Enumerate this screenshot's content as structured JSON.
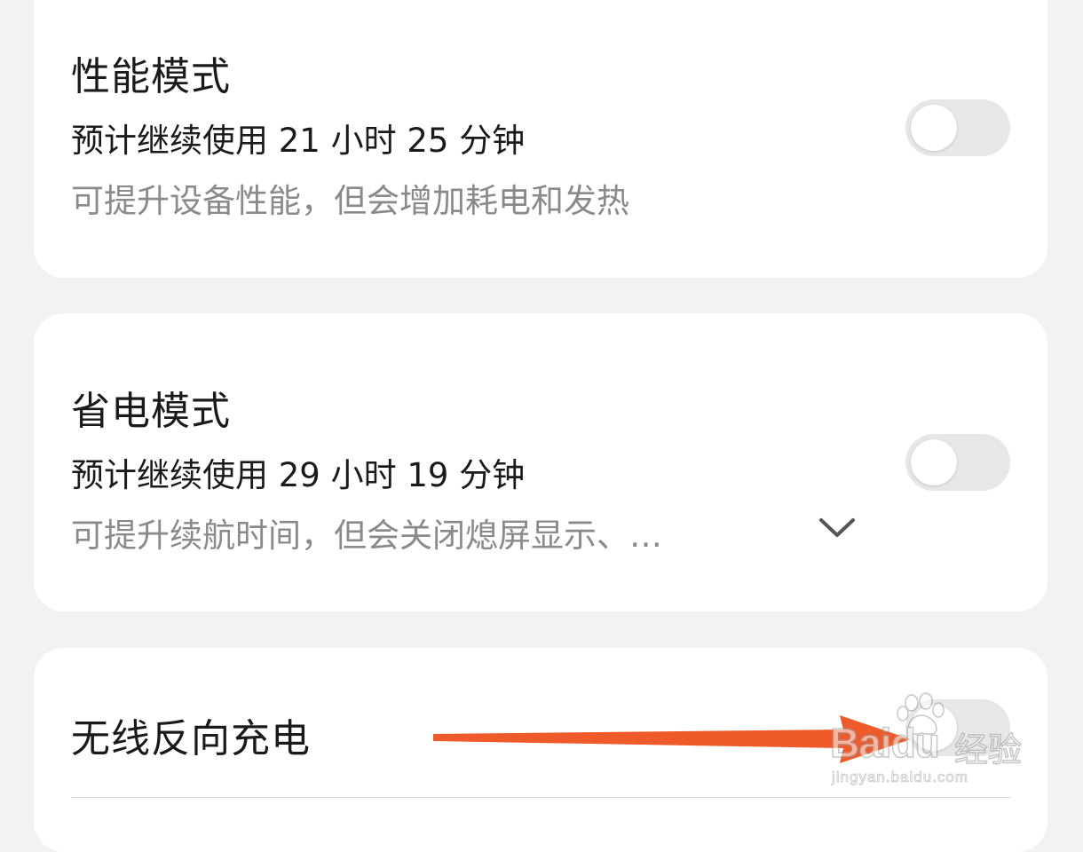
{
  "settings": {
    "performance_mode": {
      "title": "性能模式",
      "estimate": "预计继续使用 21 小时 25 分钟",
      "description": "可提升设备性能，但会增加耗电和发热",
      "enabled": false
    },
    "power_saving_mode": {
      "title": "省电模式",
      "estimate": "预计继续使用 29 小时 19 分钟",
      "description": "可提升续航时间，但会关闭熄屏显示、…",
      "expand_icon": "chevron-down-icon",
      "enabled": false
    },
    "wireless_reverse_charging": {
      "title": "无线反向充电",
      "enabled": false
    }
  },
  "annotation": {
    "arrow_color": "#ee5a2a"
  },
  "watermark": {
    "logo": "Baidu",
    "label": "经验",
    "url": "jingyan.baidu.com"
  },
  "colors": {
    "background": "#f1f2f4",
    "card": "#ffffff",
    "toggle_off": "#e7e7e9",
    "secondary_text": "#8a8a8a"
  }
}
